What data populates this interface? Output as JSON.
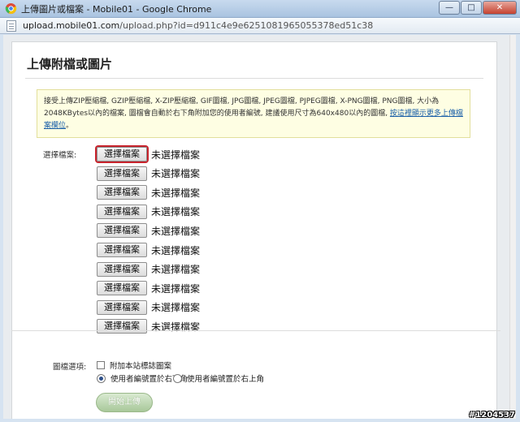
{
  "window": {
    "title": "上傳圖片或檔案 - Mobile01 - Google Chrome",
    "min_glyph": "—",
    "max_glyph": "□",
    "close_glyph": "✕"
  },
  "address": {
    "host": "upload.mobile01.com",
    "path": "/upload.php?id=d911c4e9e6251081965055378ed51c38"
  },
  "page": {
    "heading": "上傳附檔或圖片",
    "notice_text": "接受上傳ZIP壓縮檔, GZIP壓縮檔, X-ZIP壓縮檔, GIF圖檔, JPG圖檔, JPEG圖檔, PJPEG圖檔, X-PNG圖檔, PNG圖檔, 大小為2048KBytes以內的檔案, 圖檔會自動於右下角附加您的使用者編號, 建議使用尺寸為640x480以內的圖檔, ",
    "notice_link": "按這裡顯示更多上傳檔案欄位",
    "notice_end": "。",
    "file_label": "選擇檔案:",
    "file_rows": [
      {
        "button": "選擇檔案",
        "status": "未選擇檔案"
      },
      {
        "button": "選擇檔案",
        "status": "未選擇檔案"
      },
      {
        "button": "選擇檔案",
        "status": "未選擇檔案"
      },
      {
        "button": "選擇檔案",
        "status": "未選擇檔案"
      },
      {
        "button": "選擇檔案",
        "status": "未選擇檔案"
      },
      {
        "button": "選擇檔案",
        "status": "未選擇檔案"
      },
      {
        "button": "選擇檔案",
        "status": "未選擇檔案"
      },
      {
        "button": "選擇檔案",
        "status": "未選擇檔案"
      },
      {
        "button": "選擇檔案",
        "status": "未選擇檔案"
      },
      {
        "button": "選擇檔案",
        "status": "未選擇檔案"
      }
    ],
    "options_label": "圖檔選項:",
    "checkbox_label": "附加本站標誌圖案",
    "radio_bottom_right": "使用者編號置於右下角",
    "radio_top_right": "使用者編號置於右上角",
    "submit": "開始上傳"
  },
  "watermark": "#1204537"
}
